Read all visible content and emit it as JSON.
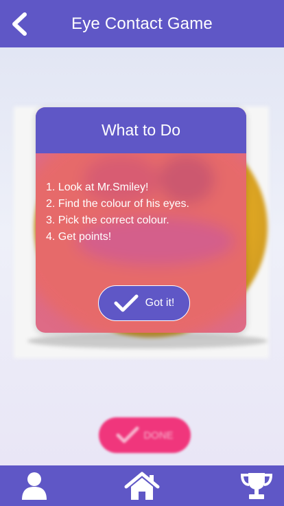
{
  "header": {
    "title": "Eye Contact Game",
    "back_icon": "chevron-left-icon"
  },
  "dialog": {
    "title": "What to Do",
    "steps": [
      "1. Look at Mr.Smiley!",
      "2. Find the colour of his eyes.",
      "3. Pick the correct colour.",
      "4. Get points!"
    ],
    "confirm_label": "Got it!",
    "confirm_icon": "check-icon"
  },
  "background": {
    "done_label": "DONE",
    "done_icon": "check-icon",
    "image": "smiley-face"
  },
  "bottom_nav": [
    {
      "icon": "user-icon"
    },
    {
      "icon": "home-icon"
    },
    {
      "icon": "trophy-icon"
    }
  ],
  "colors": {
    "primary": "#5f57c6",
    "accent_pink": "#f0367c",
    "text_light": "#ffffff"
  }
}
